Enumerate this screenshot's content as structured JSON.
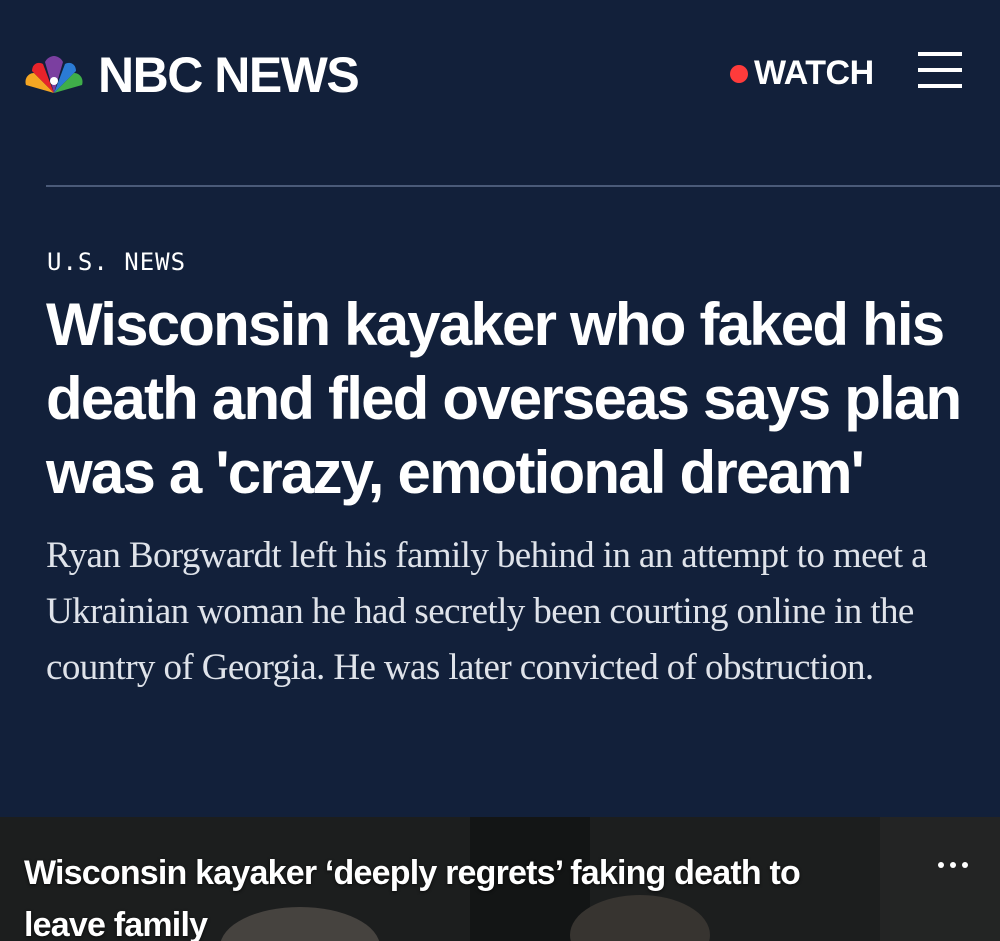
{
  "header": {
    "brand": "NBC NEWS",
    "logo_icon": "nbc-peacock-icon",
    "watch_label": "WATCH",
    "live_dot_color": "#ff3b3b",
    "menu_icon": "hamburger-menu-icon"
  },
  "article": {
    "section": "U.S. NEWS",
    "headline": "Wisconsin kayaker who faked his death and fled overseas says plan was a 'crazy, emotional dream'",
    "dek": "Ryan Borgwardt left his family behind in an attempt to meet a Ukrainian woman he had secretly been courting online in the country of Georgia. He was later convicted of obstruction."
  },
  "video": {
    "title": "Wisconsin kayaker ‘deeply regrets’ faking death to leave family",
    "more_icon": "more-options-icon"
  },
  "colors": {
    "background": "#12203a",
    "text": "#ffffff",
    "divider": "#4a5a78"
  }
}
